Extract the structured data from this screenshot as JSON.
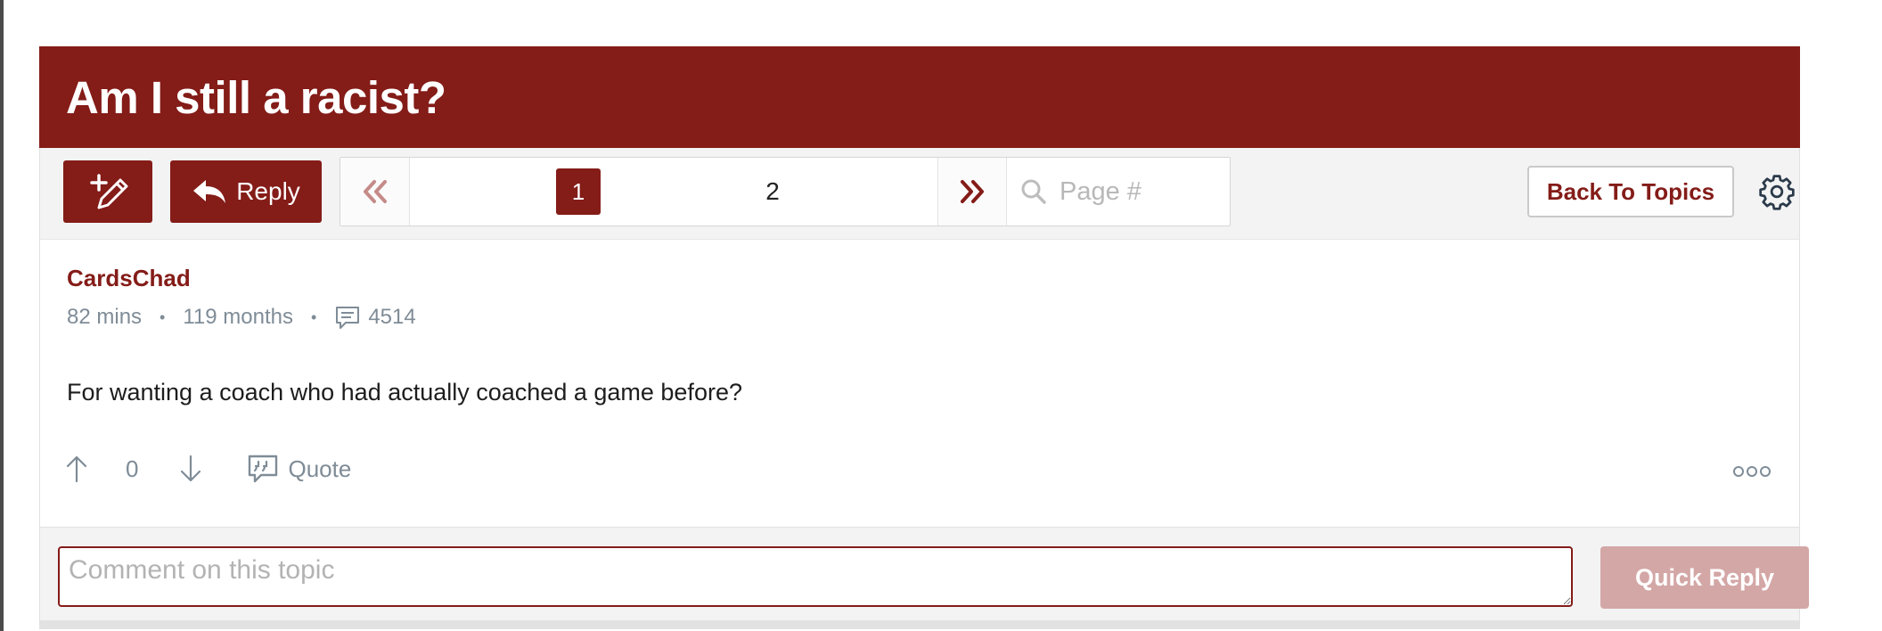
{
  "topic": {
    "title": "Am I still a racist?"
  },
  "toolbar": {
    "new_post_icon": "pencil-plus-icon",
    "reply_label": "Reply",
    "reply_icon": "reply-arrow-icon",
    "back_label": "Back To Topics",
    "settings_icon": "gear-icon"
  },
  "pagination": {
    "pages": [
      "1",
      "2"
    ],
    "current_page": "1",
    "page_input_placeholder": "Page #"
  },
  "post": {
    "author": "CardsChad",
    "posted_ago": "82 mins",
    "member_for": "119 months",
    "post_count": "4514",
    "body": "For wanting a coach who had actually coached a game before?",
    "vote_count": "0",
    "quote_label": "Quote"
  },
  "composer": {
    "placeholder": "Comment on this topic",
    "quick_reply_label": "Quick Reply"
  },
  "colors": {
    "brand": "#841c18",
    "brand_disabled": "#d3a7a6",
    "muted_text": "#7f8c97",
    "toolbar_bg": "#f3f3f4"
  }
}
